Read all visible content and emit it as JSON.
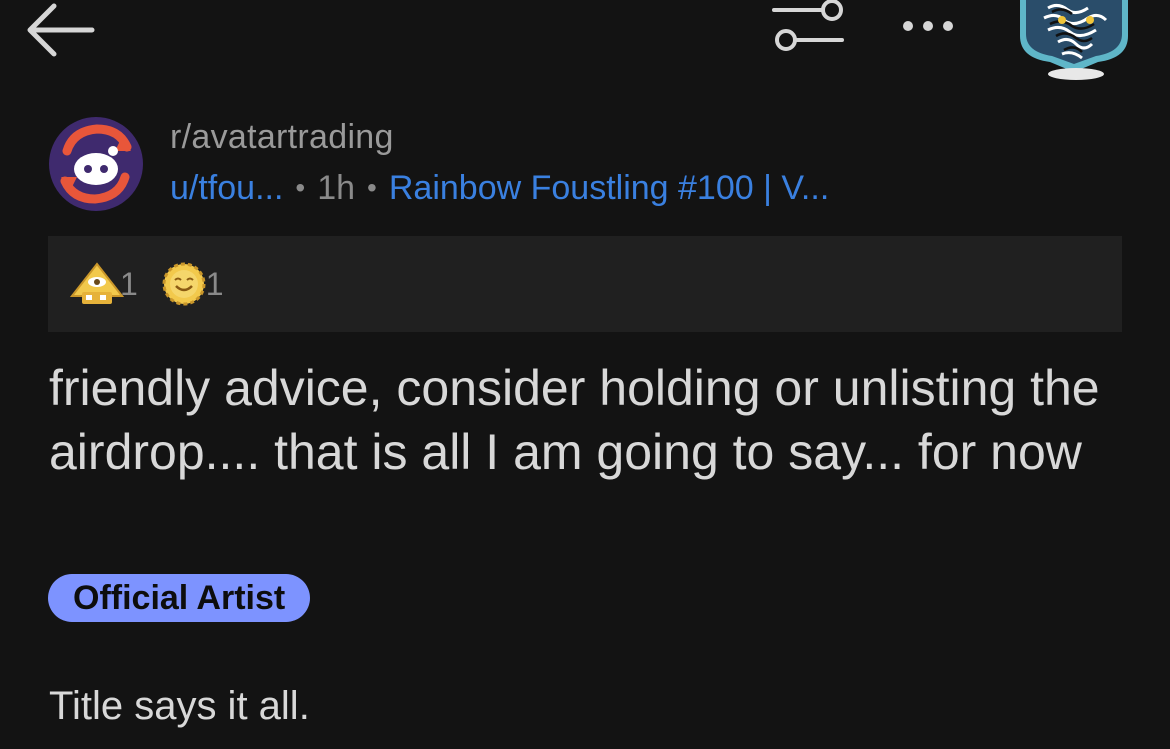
{
  "topbar": {
    "back_icon": "arrow-left-icon",
    "filter_icon": "sliders-icon",
    "more_icon": "more-horizontal-icon",
    "avatar_icon": "user-avatar"
  },
  "post": {
    "subreddit": "r/avatartrading",
    "author": "u/tfou...",
    "separator": "•",
    "time": "1h",
    "author_flair": "Rainbow Foustling #100 | V...",
    "awards": [
      {
        "icon": "pyramid-eye-award-icon",
        "count": "1"
      },
      {
        "icon": "smiling-sun-award-icon",
        "count": "1"
      }
    ],
    "title": "friendly advice, consider holding or unlisting the airdrop.... that is all I am going to say... for now",
    "flair": "Official Artist",
    "body": "Title says it all."
  },
  "colors": {
    "background": "#131313",
    "link_blue": "#3a80e0",
    "flair_bg": "#7d93ff",
    "awards_bg": "#202020"
  }
}
